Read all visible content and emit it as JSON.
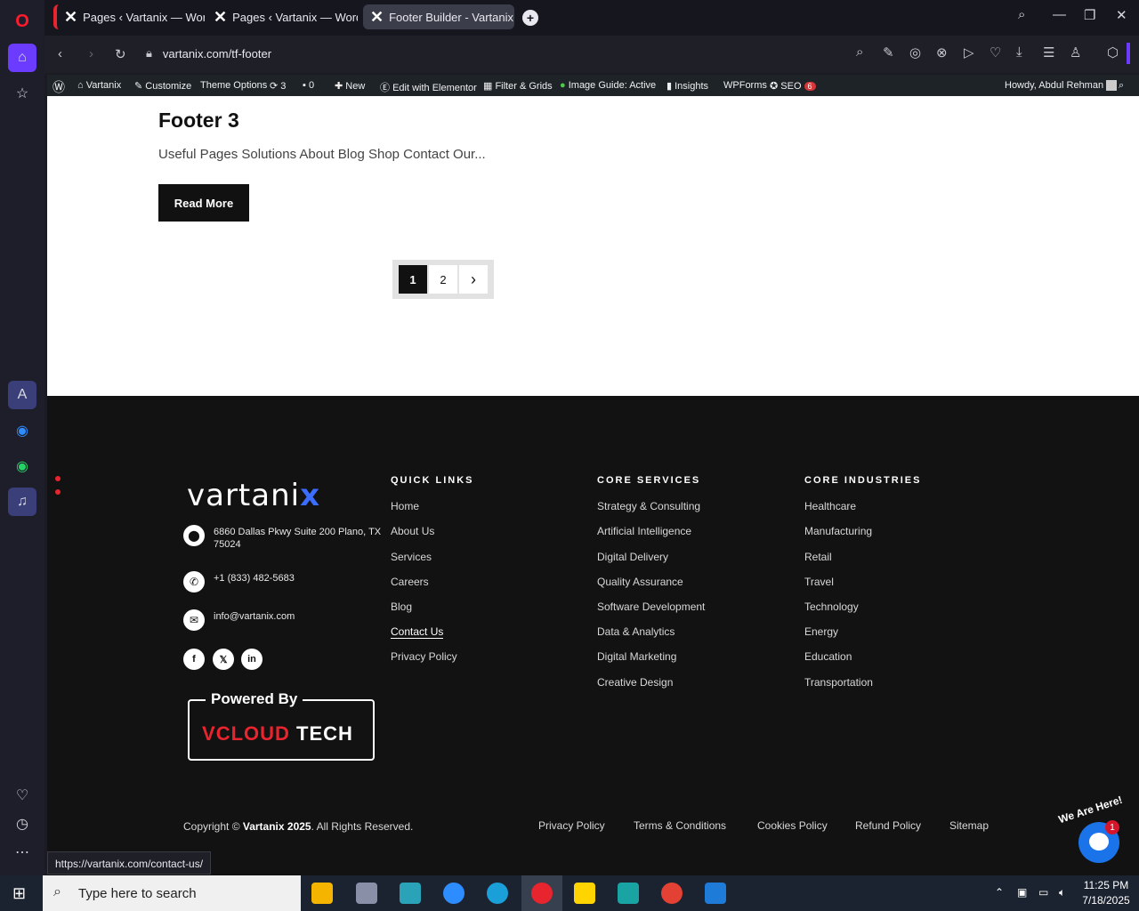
{
  "tabs": [
    {
      "label": "Pages ‹ Vartanix — WordP"
    },
    {
      "label": "Pages ‹ Vartanix — WordP"
    },
    {
      "label": "Footer Builder - Vartanix"
    }
  ],
  "address": {
    "url": "vartanix.com/tf-footer"
  },
  "wp_admin_bar": {
    "site": "Vartanix",
    "customize": "Customize",
    "theme_options": "Theme Options",
    "updates": "3",
    "comments": "0",
    "new": "New",
    "elementor": "Edit with Elementor",
    "filter_grids": "Filter & Grids",
    "image_guide": "Image Guide: Active",
    "insights": "Insights",
    "wpforms": "WPForms",
    "seo": "SEO",
    "seo_badge": "6",
    "howdy": "Howdy, Abdul Rehman"
  },
  "post": {
    "title": "Footer 3",
    "excerpt": "Useful Pages Solutions About Blog Shop Contact Our...",
    "read_more": "Read More"
  },
  "pagination": {
    "pages": [
      "1",
      "2"
    ],
    "next": "›"
  },
  "footer": {
    "logo_text": "vartani",
    "logo_accent": "x",
    "address": "6860 Dallas Pkwy Suite 200 Plano, TX 75024",
    "phone": "+1 (833) 482-5683",
    "email": "info@vartanix.com",
    "powered_by": "Powered By",
    "powered_brand_a": "V",
    "powered_brand_b": "CLOUD",
    "powered_brand_c": " TECH",
    "quick_links": {
      "heading": "QUICK LINKS",
      "items": [
        "Home",
        "About Us",
        "Services",
        "Careers",
        "Blog",
        "Contact Us",
        "Privacy Policy"
      ]
    },
    "core_services": {
      "heading": "CORE SERVICES",
      "items": [
        "Strategy & Consulting",
        "Artificial Intelligence",
        "Digital Delivery",
        "Quality Assurance",
        "Software Development",
        "Data & Analytics",
        "Digital Marketing",
        "Creative Design"
      ]
    },
    "core_industries": {
      "heading": "CORE INDUSTRIES",
      "items": [
        "Healthcare",
        "Manufacturing",
        "Retail",
        "Travel",
        "Technology",
        "Energy",
        "Education",
        "Transportation"
      ]
    },
    "copyright_a": "Copyright © ",
    "copyright_b": "Vartanix 2025",
    "copyright_c": ". All Rights Reserved.",
    "bottom_links": [
      "Privacy Policy",
      "Terms & Conditions",
      "Cookies Policy",
      "Refund Policy",
      "Sitemap"
    ]
  },
  "status_url": "https://vartanix.com/contact-us/",
  "chat": {
    "badge": "1",
    "label": "We Are Here!"
  },
  "taskbar": {
    "search_placeholder": "Type here to search",
    "time": "11:25 PM",
    "date": "7/18/2025"
  }
}
